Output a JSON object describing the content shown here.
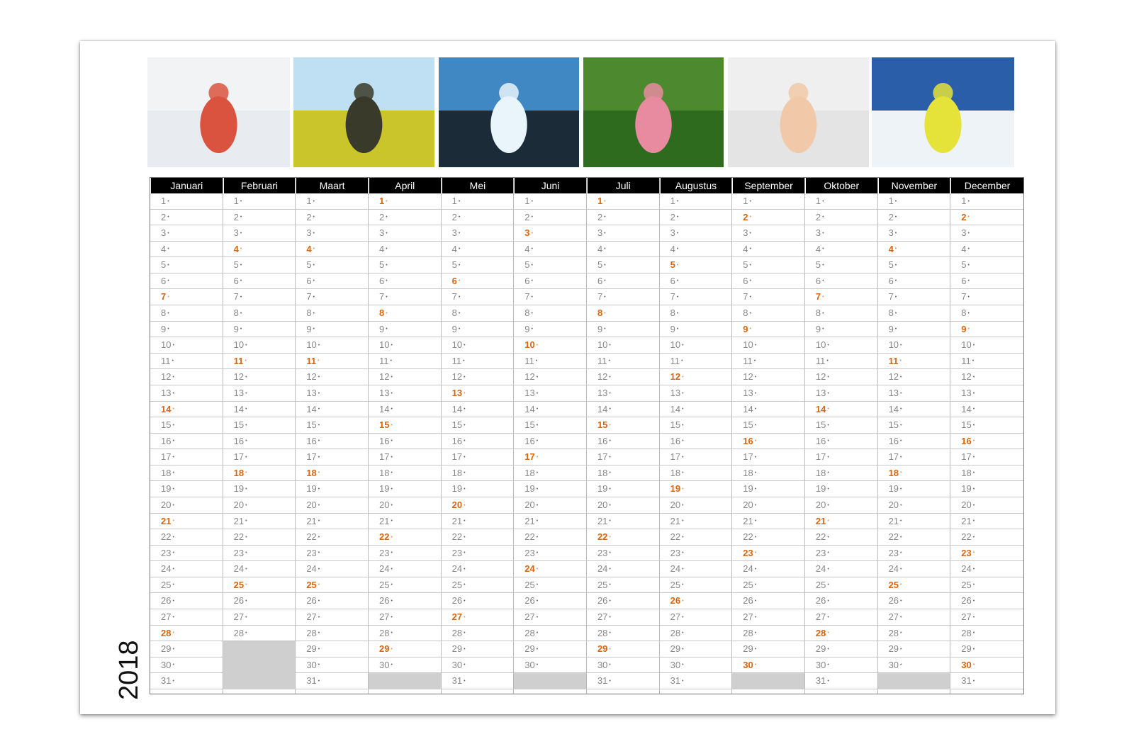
{
  "year": "2018",
  "photos": [
    {
      "name": "photo-girl-snow",
      "sky": "#f2f3f5",
      "ground": "#e8ecf0",
      "accent": "#d9533f"
    },
    {
      "name": "photo-hiker-field",
      "sky": "#bfe0f2",
      "ground": "#c9c52a",
      "accent": "#3a3a2a"
    },
    {
      "name": "photo-silhouette-sky",
      "sky": "#3f88c4",
      "ground": "#1c2b38",
      "accent": "#e9f4fb"
    },
    {
      "name": "photo-kids-log",
      "sky": "#4d8a2f",
      "ground": "#2f6b1e",
      "accent": "#e88ba0"
    },
    {
      "name": "photo-baby",
      "sky": "#efefef",
      "ground": "#e4e4e4",
      "accent": "#f1c9a8"
    },
    {
      "name": "photo-sled-snow",
      "sky": "#2b5ea8",
      "ground": "#eef3f8",
      "accent": "#e5e23a"
    }
  ],
  "colors": {
    "sunday": "#d9650d",
    "header_bg": "#000000",
    "empty": "#cfcfcf"
  },
  "months": [
    {
      "name": "Januari",
      "days": 31,
      "sundays": [
        7,
        14,
        21,
        28
      ]
    },
    {
      "name": "Februari",
      "days": 28,
      "sundays": [
        4,
        11,
        18,
        25
      ]
    },
    {
      "name": "Maart",
      "days": 31,
      "sundays": [
        4,
        11,
        18,
        25
      ]
    },
    {
      "name": "April",
      "days": 30,
      "sundays": [
        1,
        8,
        15,
        22,
        29
      ]
    },
    {
      "name": "Mei",
      "days": 31,
      "sundays": [
        6,
        13,
        20,
        27
      ]
    },
    {
      "name": "Juni",
      "days": 30,
      "sundays": [
        3,
        10,
        17,
        24
      ]
    },
    {
      "name": "Juli",
      "days": 31,
      "sundays": [
        1,
        8,
        15,
        22,
        29
      ]
    },
    {
      "name": "Augustus",
      "days": 31,
      "sundays": [
        5,
        12,
        19,
        26
      ]
    },
    {
      "name": "September",
      "days": 30,
      "sundays": [
        2,
        9,
        16,
        23,
        30
      ]
    },
    {
      "name": "Oktober",
      "days": 31,
      "sundays": [
        7,
        14,
        21,
        28
      ]
    },
    {
      "name": "November",
      "days": 30,
      "sundays": [
        4,
        11,
        18,
        25
      ]
    },
    {
      "name": "December",
      "days": 31,
      "sundays": [
        2,
        9,
        16,
        23,
        30
      ]
    }
  ]
}
